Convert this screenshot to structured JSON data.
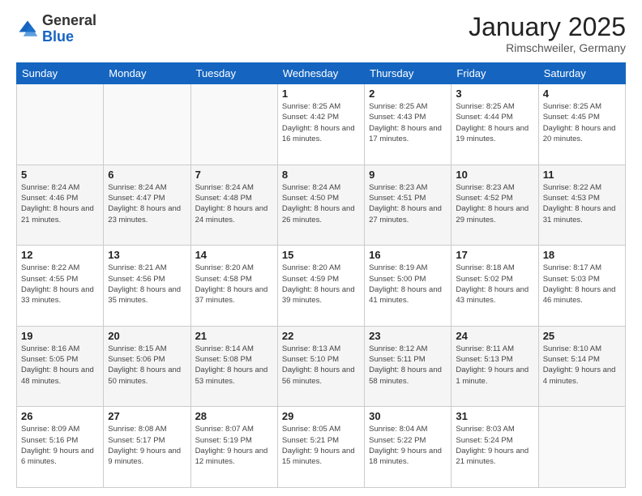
{
  "header": {
    "logo_general": "General",
    "logo_blue": "Blue",
    "month_title": "January 2025",
    "location": "Rimschweiler, Germany"
  },
  "weekdays": [
    "Sunday",
    "Monday",
    "Tuesday",
    "Wednesday",
    "Thursday",
    "Friday",
    "Saturday"
  ],
  "weeks": [
    [
      {
        "day": "",
        "info": ""
      },
      {
        "day": "",
        "info": ""
      },
      {
        "day": "",
        "info": ""
      },
      {
        "day": "1",
        "info": "Sunrise: 8:25 AM\nSunset: 4:42 PM\nDaylight: 8 hours\nand 16 minutes."
      },
      {
        "day": "2",
        "info": "Sunrise: 8:25 AM\nSunset: 4:43 PM\nDaylight: 8 hours\nand 17 minutes."
      },
      {
        "day": "3",
        "info": "Sunrise: 8:25 AM\nSunset: 4:44 PM\nDaylight: 8 hours\nand 19 minutes."
      },
      {
        "day": "4",
        "info": "Sunrise: 8:25 AM\nSunset: 4:45 PM\nDaylight: 8 hours\nand 20 minutes."
      }
    ],
    [
      {
        "day": "5",
        "info": "Sunrise: 8:24 AM\nSunset: 4:46 PM\nDaylight: 8 hours\nand 21 minutes."
      },
      {
        "day": "6",
        "info": "Sunrise: 8:24 AM\nSunset: 4:47 PM\nDaylight: 8 hours\nand 23 minutes."
      },
      {
        "day": "7",
        "info": "Sunrise: 8:24 AM\nSunset: 4:48 PM\nDaylight: 8 hours\nand 24 minutes."
      },
      {
        "day": "8",
        "info": "Sunrise: 8:24 AM\nSunset: 4:50 PM\nDaylight: 8 hours\nand 26 minutes."
      },
      {
        "day": "9",
        "info": "Sunrise: 8:23 AM\nSunset: 4:51 PM\nDaylight: 8 hours\nand 27 minutes."
      },
      {
        "day": "10",
        "info": "Sunrise: 8:23 AM\nSunset: 4:52 PM\nDaylight: 8 hours\nand 29 minutes."
      },
      {
        "day": "11",
        "info": "Sunrise: 8:22 AM\nSunset: 4:53 PM\nDaylight: 8 hours\nand 31 minutes."
      }
    ],
    [
      {
        "day": "12",
        "info": "Sunrise: 8:22 AM\nSunset: 4:55 PM\nDaylight: 8 hours\nand 33 minutes."
      },
      {
        "day": "13",
        "info": "Sunrise: 8:21 AM\nSunset: 4:56 PM\nDaylight: 8 hours\nand 35 minutes."
      },
      {
        "day": "14",
        "info": "Sunrise: 8:20 AM\nSunset: 4:58 PM\nDaylight: 8 hours\nand 37 minutes."
      },
      {
        "day": "15",
        "info": "Sunrise: 8:20 AM\nSunset: 4:59 PM\nDaylight: 8 hours\nand 39 minutes."
      },
      {
        "day": "16",
        "info": "Sunrise: 8:19 AM\nSunset: 5:00 PM\nDaylight: 8 hours\nand 41 minutes."
      },
      {
        "day": "17",
        "info": "Sunrise: 8:18 AM\nSunset: 5:02 PM\nDaylight: 8 hours\nand 43 minutes."
      },
      {
        "day": "18",
        "info": "Sunrise: 8:17 AM\nSunset: 5:03 PM\nDaylight: 8 hours\nand 46 minutes."
      }
    ],
    [
      {
        "day": "19",
        "info": "Sunrise: 8:16 AM\nSunset: 5:05 PM\nDaylight: 8 hours\nand 48 minutes."
      },
      {
        "day": "20",
        "info": "Sunrise: 8:15 AM\nSunset: 5:06 PM\nDaylight: 8 hours\nand 50 minutes."
      },
      {
        "day": "21",
        "info": "Sunrise: 8:14 AM\nSunset: 5:08 PM\nDaylight: 8 hours\nand 53 minutes."
      },
      {
        "day": "22",
        "info": "Sunrise: 8:13 AM\nSunset: 5:10 PM\nDaylight: 8 hours\nand 56 minutes."
      },
      {
        "day": "23",
        "info": "Sunrise: 8:12 AM\nSunset: 5:11 PM\nDaylight: 8 hours\nand 58 minutes."
      },
      {
        "day": "24",
        "info": "Sunrise: 8:11 AM\nSunset: 5:13 PM\nDaylight: 9 hours\nand 1 minute."
      },
      {
        "day": "25",
        "info": "Sunrise: 8:10 AM\nSunset: 5:14 PM\nDaylight: 9 hours\nand 4 minutes."
      }
    ],
    [
      {
        "day": "26",
        "info": "Sunrise: 8:09 AM\nSunset: 5:16 PM\nDaylight: 9 hours\nand 6 minutes."
      },
      {
        "day": "27",
        "info": "Sunrise: 8:08 AM\nSunset: 5:17 PM\nDaylight: 9 hours\nand 9 minutes."
      },
      {
        "day": "28",
        "info": "Sunrise: 8:07 AM\nSunset: 5:19 PM\nDaylight: 9 hours\nand 12 minutes."
      },
      {
        "day": "29",
        "info": "Sunrise: 8:05 AM\nSunset: 5:21 PM\nDaylight: 9 hours\nand 15 minutes."
      },
      {
        "day": "30",
        "info": "Sunrise: 8:04 AM\nSunset: 5:22 PM\nDaylight: 9 hours\nand 18 minutes."
      },
      {
        "day": "31",
        "info": "Sunrise: 8:03 AM\nSunset: 5:24 PM\nDaylight: 9 hours\nand 21 minutes."
      },
      {
        "day": "",
        "info": ""
      }
    ]
  ]
}
